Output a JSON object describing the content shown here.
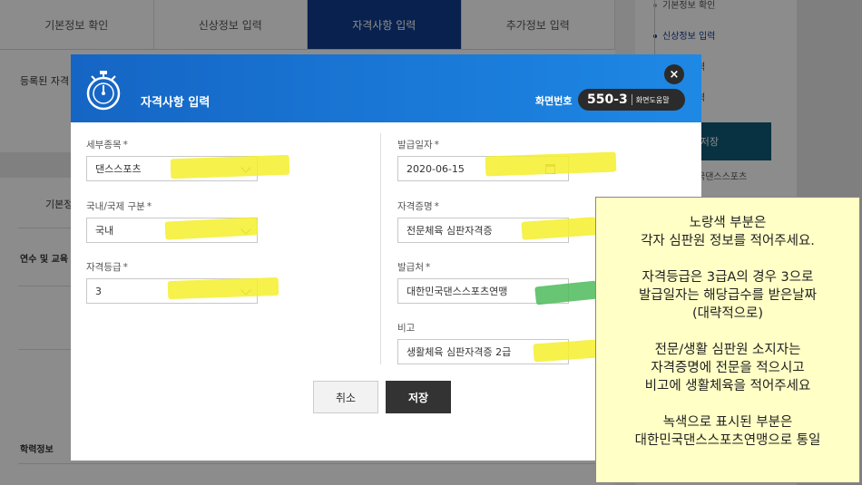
{
  "tabs": [
    {
      "label": "기본정보 확인"
    },
    {
      "label": "신상정보 입력"
    },
    {
      "label": "자격사항 입력"
    },
    {
      "label": "추가정보 입력"
    }
  ],
  "background": {
    "registered_label": "등록된 자격",
    "basic_label": "기본정",
    "training_label": "연수 및 교육",
    "education_label": "학력정보"
  },
  "side_nav": {
    "items": [
      {
        "label": "기본정보 확인"
      },
      {
        "label": "신상정보 입력"
      },
      {
        "label": "력"
      },
      {
        "label": "력"
      }
    ],
    "save_label": "저장",
    "org_label": "국댄스스포츠"
  },
  "modal": {
    "title": "자격사항 입력",
    "screen_label": "화면번호",
    "screen_code": "550-3",
    "help_label": "화면도움말",
    "close_icon": "×",
    "fields": {
      "event": {
        "label": "세부종목",
        "value": "댄스스포츠"
      },
      "scope": {
        "label": "국내/국제 구분",
        "value": "국내"
      },
      "grade": {
        "label": "자격등급",
        "value": "3"
      },
      "issue_date": {
        "label": "발급일자",
        "value": "2020-06-15"
      },
      "cert_name": {
        "label": "자격증명",
        "value": "전문체육 심판자격증"
      },
      "issuer": {
        "label": "발급처",
        "value": "대한민국댄스스포츠연맹"
      },
      "remarks": {
        "label": "비고",
        "value": "생활체육 심판자격증 2급"
      }
    },
    "required_mark": "*",
    "cancel_label": "취소",
    "save_label": "저장"
  },
  "note": {
    "lines": [
      "노랑색 부분은",
      "각자 심판원 정보를 적어주세요.",
      "자격등급은 3급A의 경우 3으로",
      "발급일자는 해당급수를 받은날짜",
      "(대략적으로)",
      "전문/생활 심판원 소지자는",
      "자격증명에 전문을 적으시고",
      "비고에 생활체육을 적어주세요",
      "녹색으로 표시된 부분은",
      "대한민국댄스스포츠연맹으로 통일"
    ]
  },
  "colors": {
    "active_tab": "#0f3c8f",
    "modal_header": "#1565c4",
    "highlight_yellow": "#f4ee2b",
    "highlight_green": "#4cbb5a",
    "note_bg": "#ffffc6"
  }
}
